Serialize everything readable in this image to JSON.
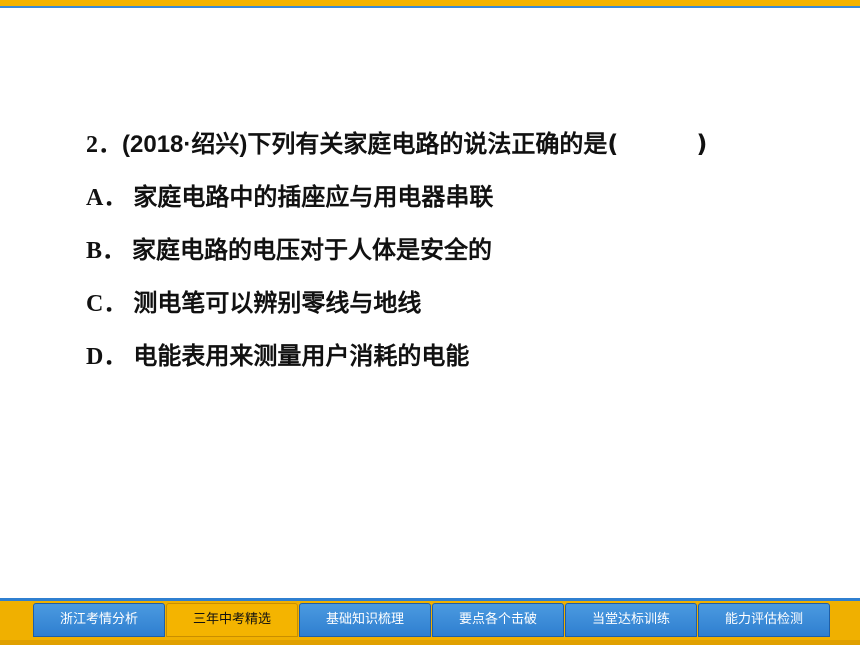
{
  "question": {
    "number": "2．",
    "source": "(2018·绍兴)",
    "stem": "下列有关家庭电路的说法正确的是(",
    "close_paren": ")",
    "options": [
      {
        "letter": "A．",
        "text": "家庭电路中的插座应与用电器串联"
      },
      {
        "letter": "B．",
        "text": "家庭电路的电压对于人体是安全的"
      },
      {
        "letter": "C．",
        "text": "测电笔可以辨别零线与地线"
      },
      {
        "letter": "D．",
        "text": "电能表用来测量用户消耗的电能"
      }
    ]
  },
  "nav": {
    "tabs": [
      {
        "label": "浙江考情分析"
      },
      {
        "label": "三年中考精选"
      },
      {
        "label": "基础知识梳理"
      },
      {
        "label": "要点各个击破"
      },
      {
        "label": "当堂达标训练"
      },
      {
        "label": "能力评估检测"
      }
    ],
    "active": "三年中考精选"
  },
  "colors": {
    "accent": "#f5b400",
    "tab_blue": "#2f7fd0"
  }
}
